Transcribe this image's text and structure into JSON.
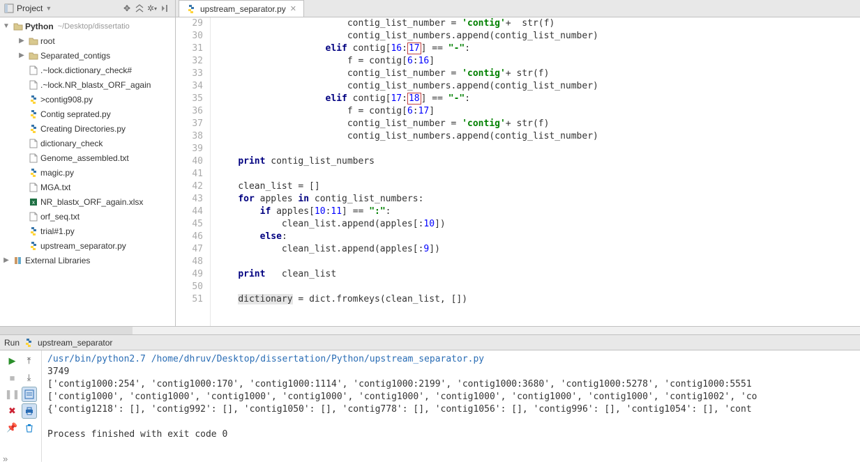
{
  "project": {
    "header_label": "Project",
    "root_name": "Python",
    "root_path": "~/Desktop/dissertatio",
    "ext_lib": "External Libraries",
    "tree": [
      {
        "type": "folder",
        "name": "root",
        "depth": 1,
        "chev": "▶"
      },
      {
        "type": "folder",
        "name": "Separated_contigs",
        "depth": 1,
        "chev": "▶"
      },
      {
        "type": "file",
        "name": ".~lock.dictionary_check#",
        "icon": "file",
        "depth": 1
      },
      {
        "type": "file",
        "name": ".~lock.NR_blastx_ORF_again",
        "icon": "file",
        "depth": 1
      },
      {
        "type": "file",
        "name": ">contig908.py",
        "icon": "py",
        "depth": 1
      },
      {
        "type": "file",
        "name": "Contig seprated.py",
        "icon": "py",
        "depth": 1
      },
      {
        "type": "file",
        "name": "Creating Directories.py",
        "icon": "py",
        "depth": 1
      },
      {
        "type": "file",
        "name": "dictionary_check",
        "icon": "file",
        "depth": 1
      },
      {
        "type": "file",
        "name": "Genome_assembled.txt",
        "icon": "file",
        "depth": 1
      },
      {
        "type": "file",
        "name": "magic.py",
        "icon": "py",
        "depth": 1
      },
      {
        "type": "file",
        "name": "MGA.txt",
        "icon": "file",
        "depth": 1
      },
      {
        "type": "file",
        "name": "NR_blastx_ORF_again.xlsx",
        "icon": "xls",
        "depth": 1
      },
      {
        "type": "file",
        "name": "orf_seq.txt",
        "icon": "file",
        "depth": 1
      },
      {
        "type": "file",
        "name": "trial#1.py",
        "icon": "py",
        "depth": 1
      },
      {
        "type": "file",
        "name": "upstream_separator.py",
        "icon": "py",
        "depth": 1
      }
    ]
  },
  "editor": {
    "tab_name": "upstream_separator.py",
    "first_line_no": 29,
    "lines": [
      [
        [
          "",
          "",
          24
        ],
        [
          "p",
          "contig_list_number = "
        ],
        [
          "s",
          "'contig'"
        ],
        [
          "p",
          "+  str(f)"
        ]
      ],
      [
        [
          "",
          "",
          24
        ],
        [
          "p",
          "contig_list_numbers.append(contig_list_number)"
        ]
      ],
      [
        [
          "",
          "",
          20
        ],
        [
          "k",
          "elif"
        ],
        [
          "p",
          " contig["
        ],
        [
          "n",
          "16"
        ],
        [
          "p",
          ":"
        ],
        [
          "nE",
          "17"
        ],
        [
          "p",
          "] == "
        ],
        [
          "s",
          "\"-\""
        ],
        [
          "p",
          ":"
        ]
      ],
      [
        [
          "",
          "",
          24
        ],
        [
          "p",
          "f = contig["
        ],
        [
          "n",
          "6"
        ],
        [
          "p",
          ":"
        ],
        [
          "n",
          "16"
        ],
        [
          "p",
          "]"
        ]
      ],
      [
        [
          "",
          "",
          24
        ],
        [
          "p",
          "contig_list_number = "
        ],
        [
          "s",
          "'contig'"
        ],
        [
          "p",
          "+ str(f)"
        ]
      ],
      [
        [
          "",
          "",
          24
        ],
        [
          "p",
          "contig_list_numbers.append(contig_list_number)"
        ]
      ],
      [
        [
          "",
          "",
          20
        ],
        [
          "k",
          "elif"
        ],
        [
          "p",
          " contig["
        ],
        [
          "n",
          "17"
        ],
        [
          "p",
          ":"
        ],
        [
          "nE",
          "18"
        ],
        [
          "p",
          "] == "
        ],
        [
          "s",
          "\"-\""
        ],
        [
          "p",
          ":"
        ]
      ],
      [
        [
          "",
          "",
          24
        ],
        [
          "p",
          "f = contig["
        ],
        [
          "n",
          "6"
        ],
        [
          "p",
          ":"
        ],
        [
          "n",
          "17"
        ],
        [
          "p",
          "]"
        ]
      ],
      [
        [
          "",
          "",
          24
        ],
        [
          "p",
          "contig_list_number = "
        ],
        [
          "s",
          "'contig'"
        ],
        [
          "p",
          "+ str(f)"
        ]
      ],
      [
        [
          "",
          "",
          24
        ],
        [
          "p",
          "contig_list_numbers.append(contig_list_number)"
        ]
      ],
      [],
      [
        [
          "",
          "",
          4
        ],
        [
          "k",
          "print"
        ],
        [
          "p",
          " contig_list_numbers"
        ]
      ],
      [],
      [
        [
          "",
          "",
          4
        ],
        [
          "p",
          "clean_list = []"
        ]
      ],
      [
        [
          "",
          "",
          4
        ],
        [
          "k",
          "for"
        ],
        [
          "p",
          " apples "
        ],
        [
          "k",
          "in"
        ],
        [
          "p",
          " contig_list_numbers:"
        ]
      ],
      [
        [
          "",
          "",
          8
        ],
        [
          "k",
          "if"
        ],
        [
          "p",
          " apples["
        ],
        [
          "n",
          "10"
        ],
        [
          "p",
          ":"
        ],
        [
          "n",
          "11"
        ],
        [
          "p",
          "] == "
        ],
        [
          "s",
          "\":\""
        ],
        [
          "p",
          ":"
        ]
      ],
      [
        [
          "",
          "",
          12
        ],
        [
          "p",
          "clean_list.append(apples[:"
        ],
        [
          "n",
          "10"
        ],
        [
          "p",
          "])"
        ]
      ],
      [
        [
          "",
          "",
          8
        ],
        [
          "k",
          "else"
        ],
        [
          "p",
          ":"
        ]
      ],
      [
        [
          "",
          "",
          12
        ],
        [
          "p",
          "clean_list.append(apples[:"
        ],
        [
          "n",
          "9"
        ],
        [
          "p",
          "])"
        ]
      ],
      [],
      [
        [
          "",
          "",
          4
        ],
        [
          "k",
          "print"
        ],
        [
          "p",
          "   clean_list"
        ]
      ],
      [],
      [
        [
          "",
          "",
          4
        ],
        [
          "w",
          "dictionary"
        ],
        [
          "p",
          " = dict.fromkeys(clean_list, [])"
        ]
      ]
    ]
  },
  "run": {
    "label": "Run",
    "config_name": "upstream_separator",
    "output": [
      {
        "cls": "cmd",
        "text": "/usr/bin/python2.7 /home/dhruv/Desktop/dissertation/Python/upstream_separator.py"
      },
      {
        "cls": "",
        "text": "3749"
      },
      {
        "cls": "",
        "text": "['contig1000:254', 'contig1000:170', 'contig1000:1114', 'contig1000:2199', 'contig1000:3680', 'contig1000:5278', 'contig1000:5551"
      },
      {
        "cls": "",
        "text": "['contig1000', 'contig1000', 'contig1000', 'contig1000', 'contig1000', 'contig1000', 'contig1000', 'contig1000', 'contig1002', 'co"
      },
      {
        "cls": "",
        "text": "{'contig1218': [], 'contig992': [], 'contig1050': [], 'contig778': [], 'contig1056': [], 'contig996': [], 'contig1054': [], 'cont"
      },
      {
        "cls": "",
        "text": ""
      },
      {
        "cls": "",
        "text": "Process finished with exit code 0"
      }
    ]
  }
}
